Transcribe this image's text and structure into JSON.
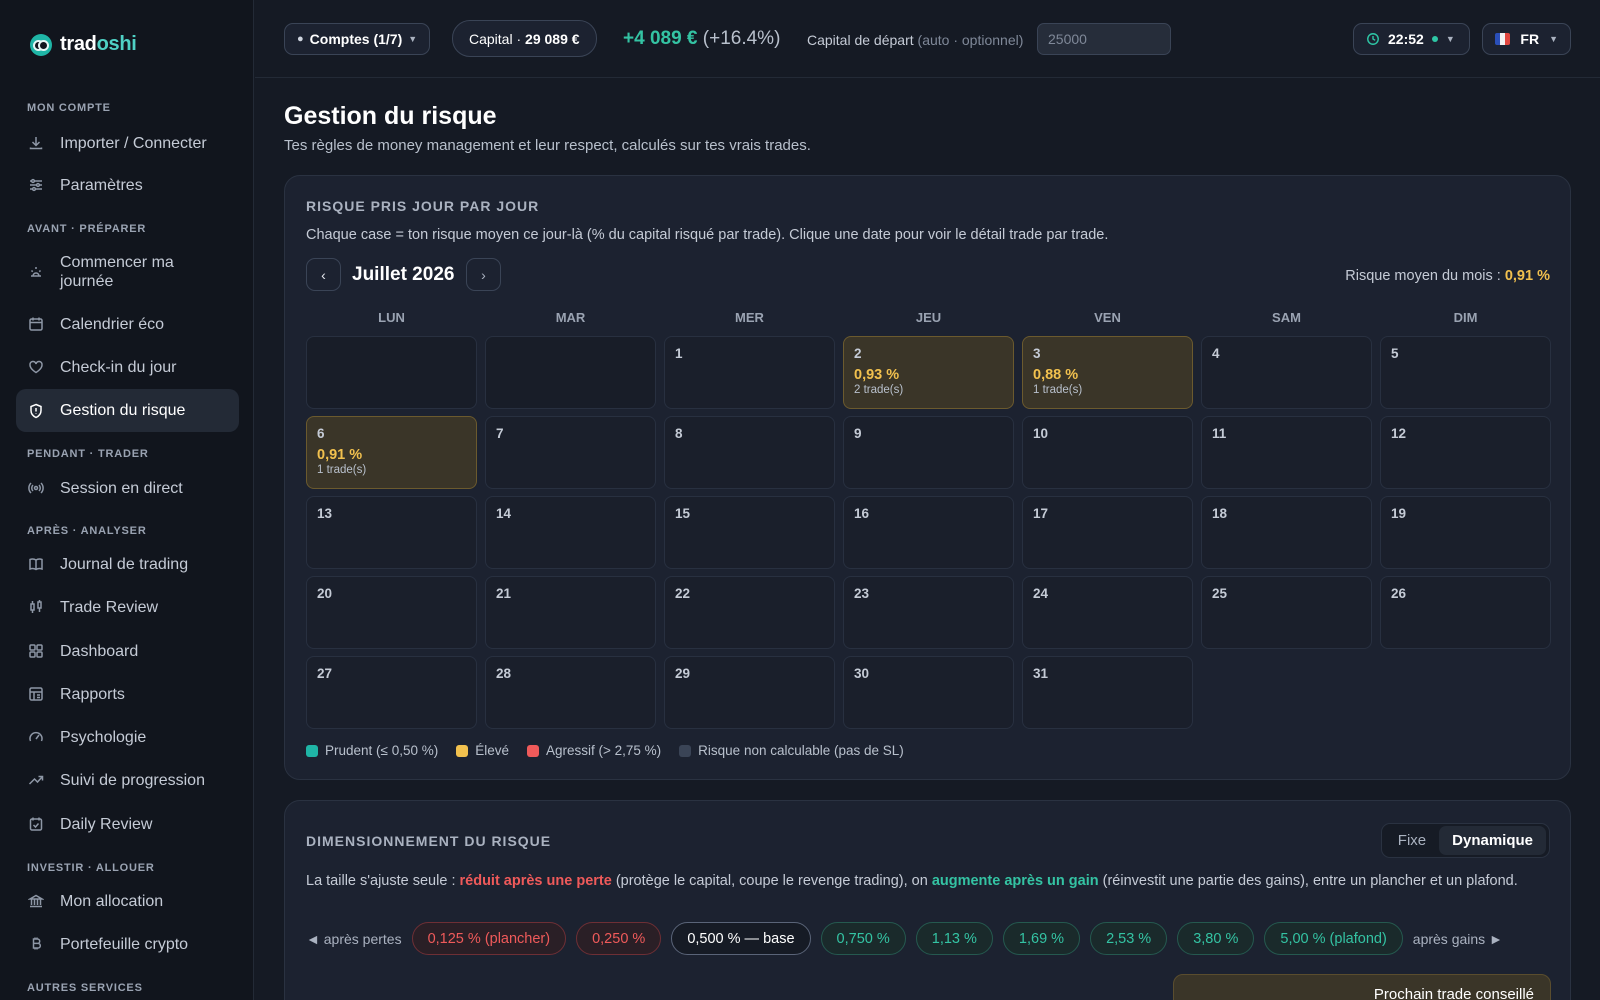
{
  "app": {
    "brand_part1": "trad",
    "brand_part2": "oshi"
  },
  "sidebar": {
    "sections": [
      {
        "label": "MON COMPTE"
      },
      {
        "label": "AVANT · PRÉPARER"
      },
      {
        "label": "PENDANT · TRADER"
      },
      {
        "label": "APRÈS · ANALYSER"
      },
      {
        "label": "INVESTIR · ALLOUER"
      },
      {
        "label": "AUTRES SERVICES"
      }
    ],
    "items": [
      {
        "label": "Importer / Connecter",
        "icon": "download-icon"
      },
      {
        "label": "Paramètres",
        "icon": "sliders-icon"
      },
      {
        "label": "Commencer ma journée",
        "icon": "sunrise-icon"
      },
      {
        "label": "Calendrier éco",
        "icon": "calendar-icon"
      },
      {
        "label": "Check-in du jour",
        "icon": "heart-icon"
      },
      {
        "label": "Gestion du risque",
        "icon": "shield-icon",
        "active": true
      },
      {
        "label": "Session en direct",
        "icon": "broadcast-icon"
      },
      {
        "label": "Journal de trading",
        "icon": "book-icon"
      },
      {
        "label": "Trade Review",
        "icon": "candlestick-icon"
      },
      {
        "label": "Dashboard",
        "icon": "grid-icon"
      },
      {
        "label": "Rapports",
        "icon": "report-icon"
      },
      {
        "label": "Psychologie",
        "icon": "gauge-icon"
      },
      {
        "label": "Suivi de progression",
        "icon": "trending-up-icon"
      },
      {
        "label": "Daily Review",
        "icon": "calendar-check-icon"
      },
      {
        "label": "Mon allocation",
        "icon": "bank-icon"
      },
      {
        "label": "Portefeuille crypto",
        "icon": "bitcoin-icon"
      }
    ]
  },
  "topbar": {
    "accounts_label": "Comptes (1/7)",
    "capital_label": "Capital · ",
    "capital_value": "29 089 €",
    "gain_value": "+4 089 €",
    "gain_pct": "(+16.4%)",
    "start_capital_label": "Capital de départ",
    "start_capital_hint": "(auto · optionnel)",
    "start_capital_placeholder": "25000",
    "clock": "22:52",
    "lang": "FR"
  },
  "page": {
    "title": "Gestion du risque",
    "subtitle": "Tes règles de money management et leur respect, calculés sur tes vrais trades."
  },
  "calendar_card": {
    "heading": "RISQUE PRIS JOUR PAR JOUR",
    "description": "Chaque case = ton risque moyen ce jour-là (% du capital risqué par trade). Clique une date pour voir le détail trade par trade.",
    "month": "Juillet 2026",
    "prev_label": "‹",
    "next_label": "›",
    "avg_label": "Risque moyen du mois : ",
    "avg_value": "0,91 %",
    "weekdays": [
      "LUN",
      "MAR",
      "MER",
      "JEU",
      "VEN",
      "SAM",
      "DIM"
    ],
    "leading_empty": 2,
    "days": [
      {
        "n": "1"
      },
      {
        "n": "2",
        "risk": "0,93 %",
        "trades": "2 trade(s)"
      },
      {
        "n": "3",
        "risk": "0,88 %",
        "trades": "1 trade(s)"
      },
      {
        "n": "4"
      },
      {
        "n": "5"
      },
      {
        "n": "6",
        "risk": "0,91 %",
        "trades": "1 trade(s)"
      },
      {
        "n": "7"
      },
      {
        "n": "8"
      },
      {
        "n": "9"
      },
      {
        "n": "10"
      },
      {
        "n": "11"
      },
      {
        "n": "12"
      },
      {
        "n": "13"
      },
      {
        "n": "14"
      },
      {
        "n": "15"
      },
      {
        "n": "16"
      },
      {
        "n": "17"
      },
      {
        "n": "18"
      },
      {
        "n": "19"
      },
      {
        "n": "20"
      },
      {
        "n": "21"
      },
      {
        "n": "22"
      },
      {
        "n": "23"
      },
      {
        "n": "24"
      },
      {
        "n": "25"
      },
      {
        "n": "26"
      },
      {
        "n": "27"
      },
      {
        "n": "28"
      },
      {
        "n": "29"
      },
      {
        "n": "30"
      },
      {
        "n": "31"
      }
    ],
    "legend": [
      {
        "label": "Prudent (≤ 0,50 %)",
        "color": "#1fb5a6"
      },
      {
        "label": "Élevé",
        "color": "#f2c14e"
      },
      {
        "label": "Agressif (> 2,75 %)",
        "color": "#ef5a5a"
      },
      {
        "label": "Risque non calculable (pas de SL)",
        "color": "#3a4456"
      }
    ]
  },
  "sizing_card": {
    "heading": "DIMENSIONNEMENT DU RISQUE",
    "toggle_fixed": "Fixe",
    "toggle_dynamic": "Dynamique",
    "desc_1": "La taille s'ajuste seule : ",
    "desc_red": "réduit après une perte",
    "desc_2": " (protège le capital, coupe le revenge trading), on ",
    "desc_green": "augmente après un gain",
    "desc_3": " (réinvestit une partie des gains), entre un plancher et un plafond.",
    "left_label": "◄ après pertes",
    "right_label": "après gains ►",
    "chips": [
      {
        "label": "0,125 % (plancher)",
        "kind": "red"
      },
      {
        "label": "0,250 %",
        "kind": "red"
      },
      {
        "label": "0,500 % — base",
        "kind": "base"
      },
      {
        "label": "0,750 %",
        "kind": "green"
      },
      {
        "label": "1,13 %",
        "kind": "green"
      },
      {
        "label": "1,69 %",
        "kind": "green"
      },
      {
        "label": "2,53 %",
        "kind": "green"
      },
      {
        "label": "3,80 %",
        "kind": "green"
      },
      {
        "label": "5,00 % (plafond)",
        "kind": "green"
      }
    ],
    "next_trade_label": "Prochain trade conseillé"
  }
}
